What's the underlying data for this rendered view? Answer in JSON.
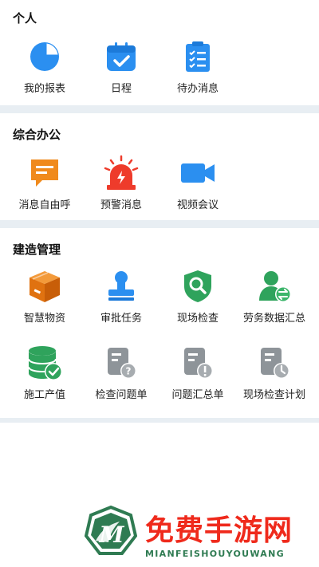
{
  "sections": [
    {
      "title": "个人",
      "items": [
        {
          "label": "我的报表",
          "icon": "pie-chart-icon"
        },
        {
          "label": "日程",
          "icon": "calendar-check-icon"
        },
        {
          "label": "待办消息",
          "icon": "clipboard-checklist-icon"
        }
      ]
    },
    {
      "title": "综合办公",
      "items": [
        {
          "label": "消息自由呼",
          "icon": "chat-bubble-icon"
        },
        {
          "label": "预警消息",
          "icon": "alarm-siren-icon"
        },
        {
          "label": "视频会议",
          "icon": "video-camera-icon"
        }
      ]
    },
    {
      "title": "建造管理",
      "items": [
        {
          "label": "智慧物资",
          "icon": "box-icon"
        },
        {
          "label": "审批任务",
          "icon": "stamp-icon"
        },
        {
          "label": "现场检查",
          "icon": "shield-search-icon"
        },
        {
          "label": "劳务数据汇总",
          "icon": "user-exchange-icon"
        },
        {
          "label": "施工产值",
          "icon": "database-check-icon"
        },
        {
          "label": "检查问题单",
          "icon": "doc-question-icon"
        },
        {
          "label": "问题汇总单",
          "icon": "doc-alert-icon"
        },
        {
          "label": "现场检查计划",
          "icon": "doc-clock-icon"
        }
      ]
    }
  ],
  "watermark": {
    "text": "免费手游网",
    "subtext": "MIANFEISHOUYOUWANG"
  },
  "colors": {
    "blue": "#2b8ff0",
    "orange": "#f08a1c",
    "red": "#ee3b2b",
    "green": "#2fa35c",
    "gray": "#8e9499",
    "divider": "#e8eef3"
  }
}
